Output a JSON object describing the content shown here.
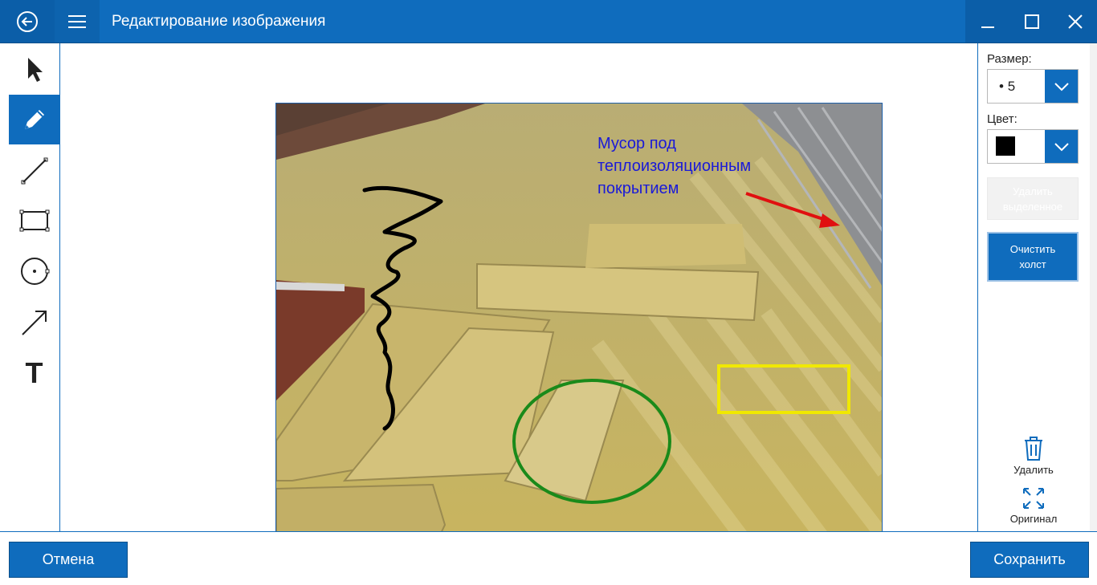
{
  "window": {
    "title": "Редактирование изображения"
  },
  "toolbar": {
    "tools": [
      {
        "icon": "pointer-icon"
      },
      {
        "icon": "pen-icon",
        "active": true
      },
      {
        "icon": "line-icon"
      },
      {
        "icon": "rectangle-icon"
      },
      {
        "icon": "circle-icon"
      },
      {
        "icon": "arrow-icon"
      },
      {
        "icon": "text-icon",
        "glyph": "T"
      }
    ]
  },
  "canvas": {
    "annotation_text": [
      "Мусор под",
      "теплоизоляционным",
      "покрытием"
    ],
    "colors": {
      "scribble": "#000000",
      "text": "#1a1ad8",
      "arrow": "#e01010",
      "circle": "#1a8a1a",
      "rectangle": "#f0e800"
    }
  },
  "panel": {
    "size_label": "Размер:",
    "size_value": "5",
    "color_label": "Цвет:",
    "selected_color": "#000000",
    "delete_selected_line1": "Удалить",
    "delete_selected_line2": "выделенное",
    "clear_canvas_line1": "Очистить",
    "clear_canvas_line2": "холст",
    "delete_label": "Удалить",
    "original_label": "Оригинал"
  },
  "footer": {
    "cancel_label": "Отмена",
    "save_label": "Сохранить"
  },
  "theme": {
    "accent": "#0f6cbd"
  }
}
